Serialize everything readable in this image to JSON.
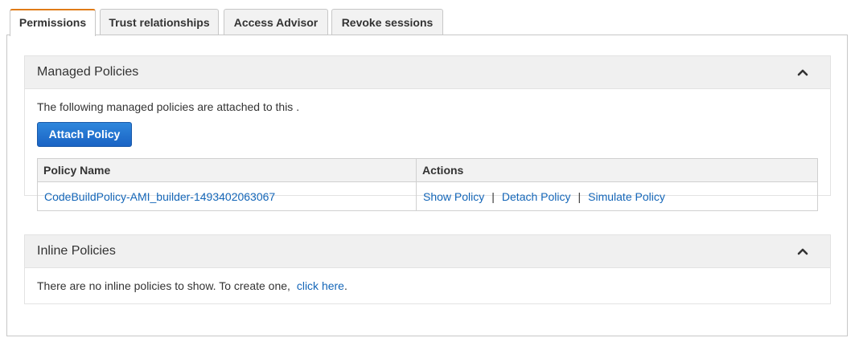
{
  "tabs": [
    {
      "label": "Permissions",
      "active": true
    },
    {
      "label": "Trust relationships",
      "active": false
    },
    {
      "label": "Access Advisor",
      "active": false
    },
    {
      "label": "Revoke sessions",
      "active": false
    }
  ],
  "managed": {
    "title": "Managed Policies",
    "description": "The following managed policies are attached to this .",
    "attach_label": "Attach Policy",
    "columns": [
      "Policy Name",
      "Actions"
    ],
    "rows": [
      {
        "name": "CodeBuildPolicy-AMI_builder-1493402063067",
        "actions": [
          "Show Policy",
          "Detach Policy",
          "Simulate Policy"
        ],
        "separator": "|"
      }
    ]
  },
  "inline": {
    "title": "Inline Policies",
    "text_before": "There are no inline policies to show. To create one,",
    "link_label": "click here",
    "text_after": "."
  },
  "colors": {
    "accent_tab": "#e07b18",
    "button_blue": "#1a63c4",
    "link_blue": "#1466b8"
  },
  "icons": {
    "collapse": "chevron-up-icon"
  }
}
